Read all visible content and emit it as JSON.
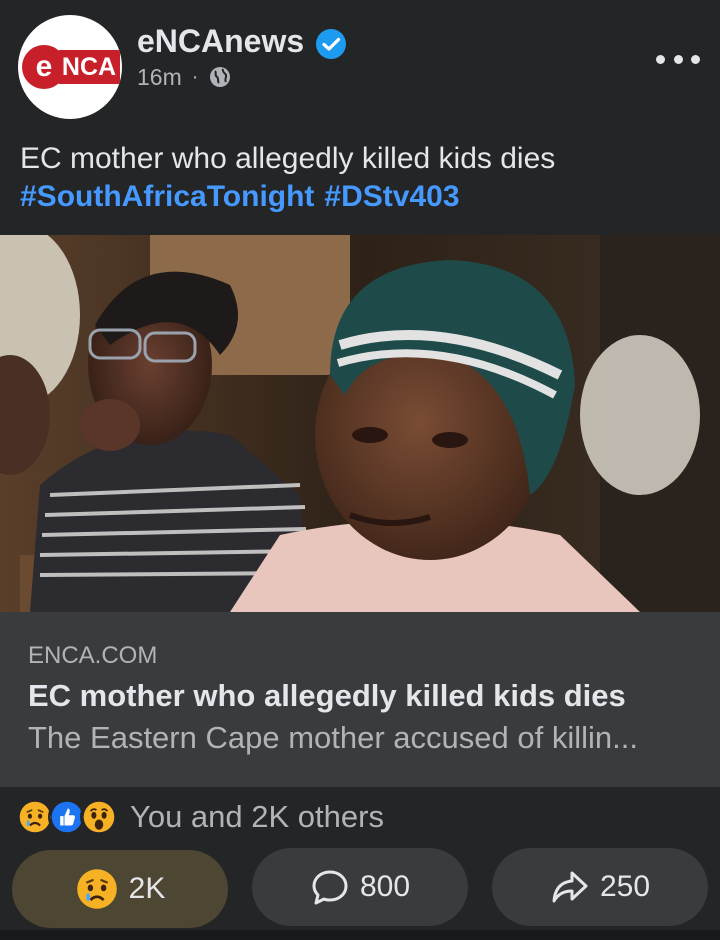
{
  "post": {
    "page_name": "eNCAnews",
    "avatar_logo": {
      "left": "e",
      "right": "NCA"
    },
    "time": "16m",
    "dot": "·",
    "privacy_icon": "globe-icon",
    "caption_text": "EC mother who allegedly killed kids dies",
    "hashtags": [
      "#SouthAfricaTonight",
      "#DStv403"
    ]
  },
  "link_preview": {
    "domain": "ENCA.COM",
    "title": "EC mother who allegedly killed kids dies",
    "description": "The Eastern Cape mother accused of killin..."
  },
  "reactions": {
    "icons": [
      "sad-emoji-icon",
      "like-icon",
      "wow-emoji-icon"
    ],
    "summary": "You and 2K others"
  },
  "actions": {
    "react_count": "2K",
    "react_icon": "sad-emoji-icon",
    "comment_count": "800",
    "comment_icon": "comment-bubble-icon",
    "share_count": "250",
    "share_icon": "share-arrow-icon"
  },
  "colors": {
    "background": "#242526",
    "card": "#3a3b3c",
    "hashtag": "#4599ff",
    "verified": "#1d9bf0",
    "brand_red": "#c8202a",
    "active_reaction": "#4c4632"
  }
}
